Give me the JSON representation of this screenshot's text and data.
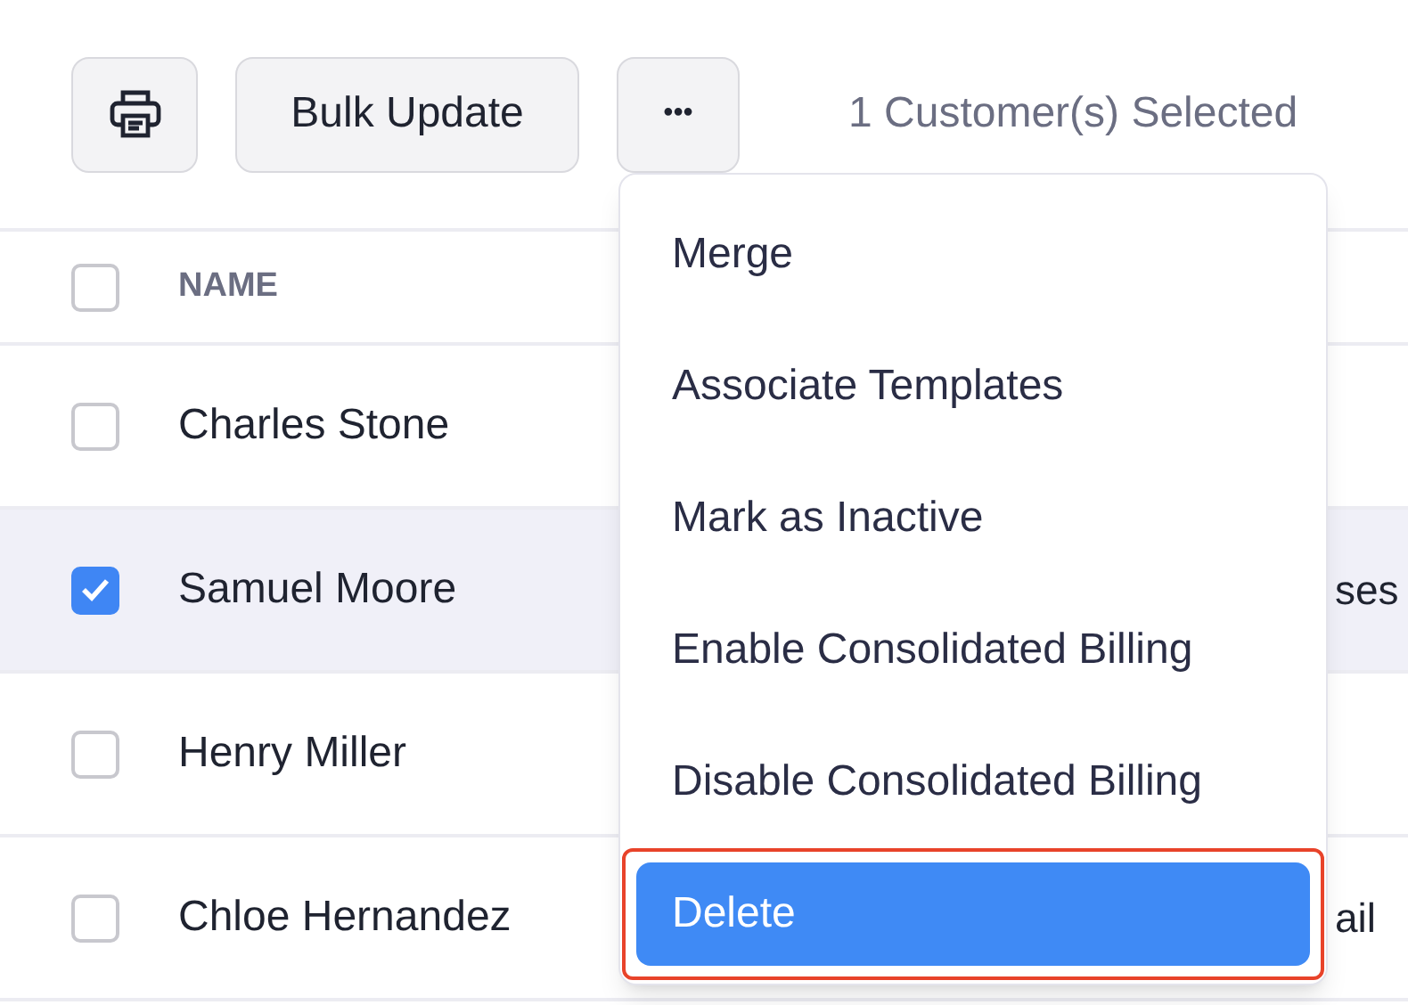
{
  "toolbar": {
    "bulk_update_label": "Bulk Update",
    "more_label": "•••",
    "selection_text": "1 Customer(s) Selected"
  },
  "table": {
    "columns": [
      {
        "label": "NAME"
      }
    ],
    "header_checked": false,
    "rows": [
      {
        "name": "Charles Stone",
        "selected": false
      },
      {
        "name": "Samuel Moore",
        "selected": true,
        "column_2": "ses"
      },
      {
        "name": "Henry Miller",
        "selected": false
      },
      {
        "name": "Chloe Hernandez",
        "selected": false,
        "column_2": "ail"
      }
    ]
  },
  "menu": {
    "items": [
      {
        "label": "Merge",
        "selected": false,
        "highlighted": false
      },
      {
        "label": "Associate Templates",
        "selected": false,
        "highlighted": false
      },
      {
        "label": "Mark as Inactive",
        "selected": false,
        "highlighted": false
      },
      {
        "label": "Enable Consolidated Billing",
        "selected": false,
        "highlighted": false
      },
      {
        "label": "Disable Consolidated Billing",
        "selected": false,
        "highlighted": false
      },
      {
        "label": "Delete",
        "selected": true,
        "highlighted": true
      }
    ]
  }
}
